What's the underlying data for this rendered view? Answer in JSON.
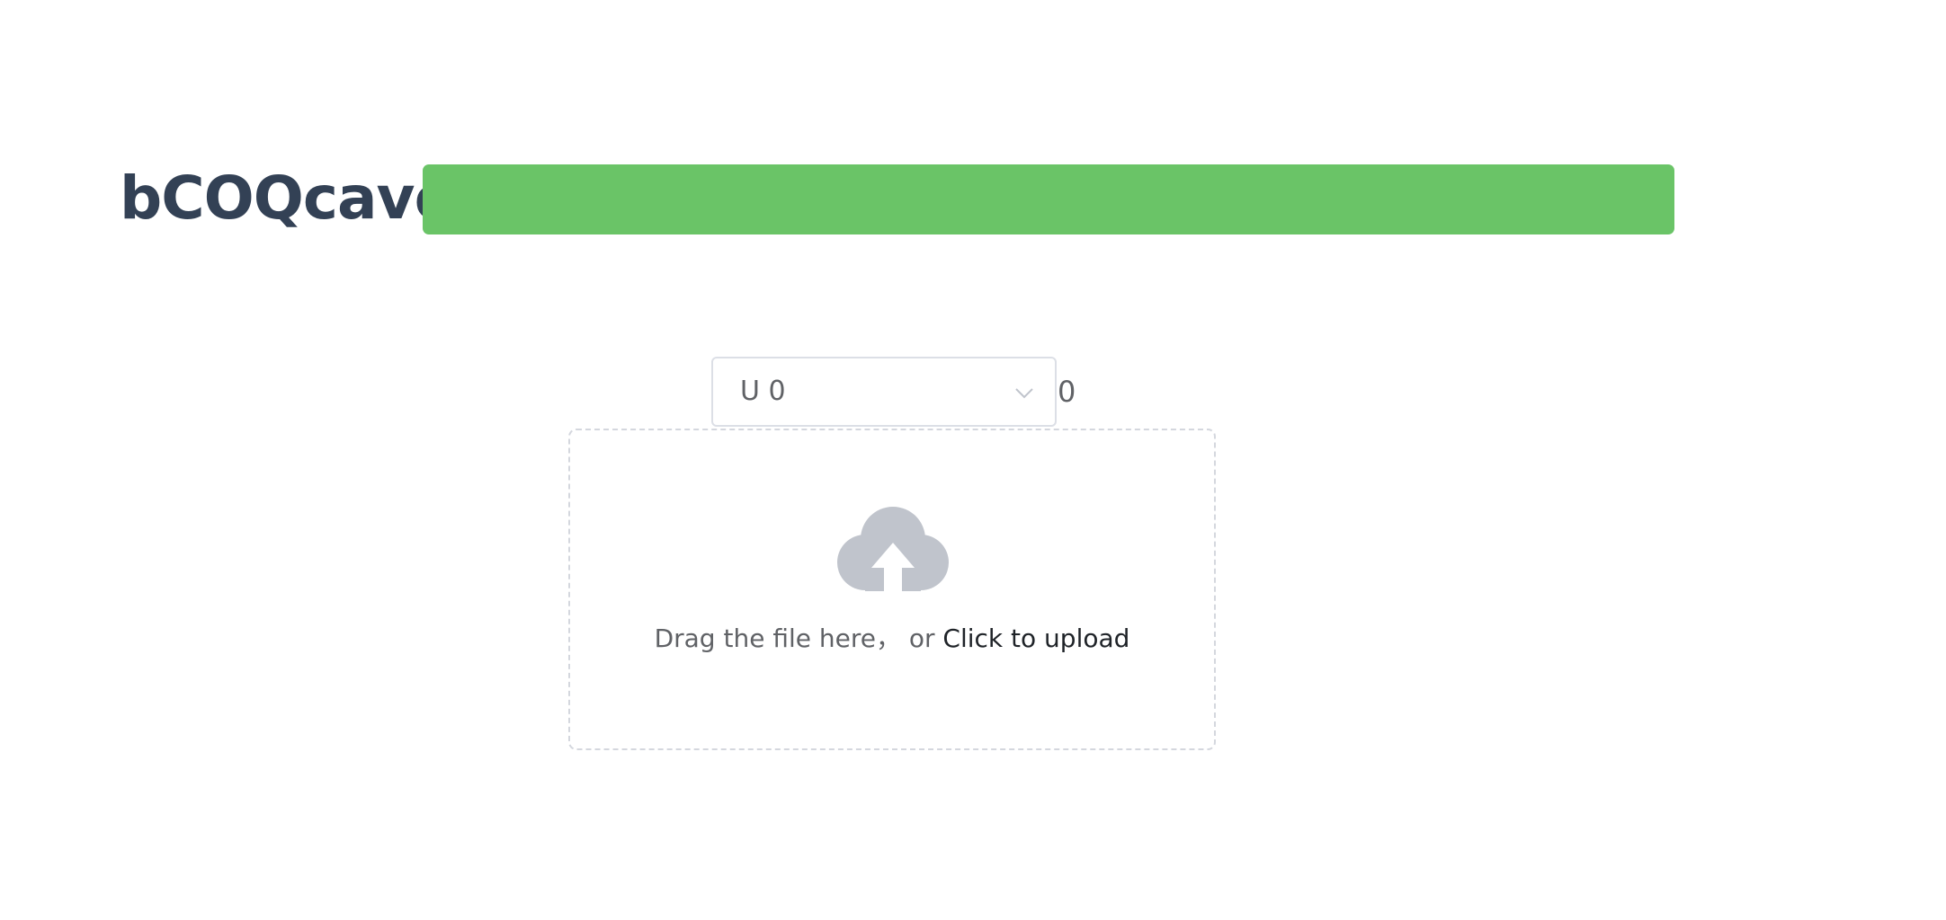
{
  "header": {
    "title": "bCOQcavo",
    "bar_color": "#6ac467"
  },
  "select": {
    "value": "U 0",
    "suffix": "0",
    "arrow_icon": "chevron-down-icon"
  },
  "upload": {
    "icon": "cloud-upload-icon",
    "drag_text": "Drag the file here， or ",
    "link_text": "Click to upload"
  },
  "colors": {
    "title": "#334155",
    "accent_bar": "#6ac467",
    "icon": "#c0c4cc",
    "border": "#dcdfe6"
  }
}
